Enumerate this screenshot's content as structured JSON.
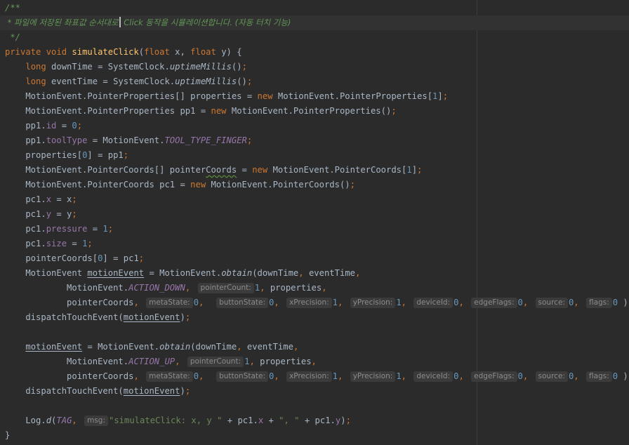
{
  "editor": {
    "theme": "darcula",
    "colors": {
      "background": "#2b2b2b",
      "current_line": "#323232",
      "keyword": "#cc7832",
      "comment": "#629755",
      "method": "#ffc66d",
      "field": "#9876aa",
      "number": "#6897bb",
      "string": "#6a8759",
      "default_text": "#a9b7c6",
      "inlay_hint_bg": "#3b3b3b",
      "inlay_hint_text": "#8c8c8c"
    },
    "lines": [
      {
        "current": false,
        "tokens": [
          {
            "t": "/**",
            "k": "comment"
          }
        ]
      },
      {
        "current": true,
        "tokens": [
          {
            "t": " * 파일에 저장된 좌표값 순서대로",
            "k": "comment"
          },
          {
            "caret": true
          },
          {
            "t": " Click 동작을 시뮬레이션합니다. (자동 터치 기능)",
            "k": "comment"
          }
        ]
      },
      {
        "current": false,
        "tokens": [
          {
            "t": " */",
            "k": "comment"
          }
        ]
      },
      {
        "current": false,
        "tokens": [
          {
            "t": "private ",
            "k": "kw"
          },
          {
            "t": "void ",
            "k": "kw"
          },
          {
            "t": "simulateClick",
            "k": "method"
          },
          {
            "t": "("
          },
          {
            "t": "float ",
            "k": "kw"
          },
          {
            "t": "x, "
          },
          {
            "t": "float ",
            "k": "kw"
          },
          {
            "t": "y) {"
          }
        ]
      },
      {
        "current": false,
        "tokens": [
          {
            "t": "    "
          },
          {
            "t": "long ",
            "k": "kw"
          },
          {
            "t": "downTime = SystemClock."
          },
          {
            "t": "uptimeMillis",
            "k": "italic"
          },
          {
            "t": "()"
          },
          {
            "t": ";",
            "k": "kw"
          }
        ]
      },
      {
        "current": false,
        "tokens": [
          {
            "t": "    "
          },
          {
            "t": "long ",
            "k": "kw"
          },
          {
            "t": "eventTime = SystemClock."
          },
          {
            "t": "uptimeMillis",
            "k": "italic"
          },
          {
            "t": "()"
          },
          {
            "t": ";",
            "k": "kw"
          }
        ]
      },
      {
        "current": false,
        "tokens": [
          {
            "t": "    MotionEvent.PointerProperties[] properties = "
          },
          {
            "t": "new ",
            "k": "kw"
          },
          {
            "t": "MotionEvent.PointerProperties["
          },
          {
            "t": "1",
            "k": "num"
          },
          {
            "t": "]"
          },
          {
            "t": ";",
            "k": "kw"
          }
        ]
      },
      {
        "current": false,
        "tokens": [
          {
            "t": "    MotionEvent.PointerProperties pp1 = "
          },
          {
            "t": "new ",
            "k": "kw"
          },
          {
            "t": "MotionEvent.PointerProperties()"
          },
          {
            "t": ";",
            "k": "kw"
          }
        ]
      },
      {
        "current": false,
        "tokens": [
          {
            "t": "    pp1."
          },
          {
            "t": "id",
            "k": "field"
          },
          {
            "t": " = "
          },
          {
            "t": "0",
            "k": "num"
          },
          {
            "t": ";",
            "k": "kw"
          }
        ]
      },
      {
        "current": false,
        "tokens": [
          {
            "t": "    pp1."
          },
          {
            "t": "toolType",
            "k": "field"
          },
          {
            "t": " = MotionEvent."
          },
          {
            "t": "TOOL_TYPE_FINGER",
            "k": "static"
          },
          {
            "t": ";",
            "k": "kw"
          }
        ]
      },
      {
        "current": false,
        "tokens": [
          {
            "t": "    properties["
          },
          {
            "t": "0",
            "k": "num"
          },
          {
            "t": "] = pp1"
          },
          {
            "t": ";",
            "k": "kw"
          }
        ]
      },
      {
        "current": false,
        "tokens": [
          {
            "t": "    MotionEvent.PointerCoords[] pointer"
          },
          {
            "t": "Coords",
            "k": "typo"
          },
          {
            "t": " = "
          },
          {
            "t": "new ",
            "k": "kw"
          },
          {
            "t": "MotionEvent.PointerCoords["
          },
          {
            "t": "1",
            "k": "num"
          },
          {
            "t": "]"
          },
          {
            "t": ";",
            "k": "kw"
          }
        ]
      },
      {
        "current": false,
        "tokens": [
          {
            "t": "    MotionEvent.PointerCoords pc1 = "
          },
          {
            "t": "new ",
            "k": "kw"
          },
          {
            "t": "MotionEvent.PointerCoords()"
          },
          {
            "t": ";",
            "k": "kw"
          }
        ]
      },
      {
        "current": false,
        "tokens": [
          {
            "t": "    pc1."
          },
          {
            "t": "x",
            "k": "field"
          },
          {
            "t": " = x"
          },
          {
            "t": ";",
            "k": "kw"
          }
        ]
      },
      {
        "current": false,
        "tokens": [
          {
            "t": "    pc1."
          },
          {
            "t": "y",
            "k": "field"
          },
          {
            "t": " = y"
          },
          {
            "t": ";",
            "k": "kw"
          }
        ]
      },
      {
        "current": false,
        "tokens": [
          {
            "t": "    pc1."
          },
          {
            "t": "pressure",
            "k": "field"
          },
          {
            "t": " = "
          },
          {
            "t": "1",
            "k": "num"
          },
          {
            "t": ";",
            "k": "kw"
          }
        ]
      },
      {
        "current": false,
        "tokens": [
          {
            "t": "    pc1."
          },
          {
            "t": "size",
            "k": "field"
          },
          {
            "t": " = "
          },
          {
            "t": "1",
            "k": "num"
          },
          {
            "t": ";",
            "k": "kw"
          }
        ]
      },
      {
        "current": false,
        "tokens": [
          {
            "t": "    pointerCoords["
          },
          {
            "t": "0",
            "k": "num"
          },
          {
            "t": "] = pc1"
          },
          {
            "t": ";",
            "k": "kw"
          }
        ]
      },
      {
        "current": false,
        "tokens": [
          {
            "t": "    MotionEvent "
          },
          {
            "t": "motionEvent",
            "k": "under"
          },
          {
            "t": " = MotionEvent."
          },
          {
            "t": "obtain",
            "k": "italic"
          },
          {
            "t": "(downTime"
          },
          {
            "t": ", ",
            "k": "kw"
          },
          {
            "t": "eventTime"
          },
          {
            "t": ",",
            "k": "kw"
          }
        ]
      },
      {
        "current": false,
        "tokens": [
          {
            "t": "            MotionEvent."
          },
          {
            "t": "ACTION_DOWN",
            "k": "static"
          },
          {
            "t": ", ",
            "k": "kw"
          },
          {
            "hint": "pointerCount:"
          },
          {
            "t": "1",
            "k": "num"
          },
          {
            "t": ", ",
            "k": "kw"
          },
          {
            "t": "properties"
          },
          {
            "t": ",",
            "k": "kw"
          }
        ]
      },
      {
        "current": false,
        "tokens": [
          {
            "t": "            pointerCoords"
          },
          {
            "t": ", ",
            "k": "kw"
          },
          {
            "hint": "metaState:"
          },
          {
            "t": "0",
            "k": "num"
          },
          {
            "t": ",  ",
            "k": "kw"
          },
          {
            "hint": "buttonState:"
          },
          {
            "t": "0",
            "k": "num"
          },
          {
            "t": ", ",
            "k": "kw"
          },
          {
            "hint": "xPrecision:"
          },
          {
            "t": "1",
            "k": "num"
          },
          {
            "t": ", ",
            "k": "kw"
          },
          {
            "hint": "yPrecision:"
          },
          {
            "t": "1",
            "k": "num"
          },
          {
            "t": ", ",
            "k": "kw"
          },
          {
            "hint": "deviceId:"
          },
          {
            "t": "0",
            "k": "num"
          },
          {
            "t": ", ",
            "k": "kw"
          },
          {
            "hint": "edgeFlags:"
          },
          {
            "t": "0",
            "k": "num"
          },
          {
            "t": ", ",
            "k": "kw"
          },
          {
            "hint": "source:"
          },
          {
            "t": "0",
            "k": "num"
          },
          {
            "t": ", ",
            "k": "kw"
          },
          {
            "hint": "flags:"
          },
          {
            "t": "0",
            "k": "num"
          },
          {
            "t": " )"
          },
          {
            "t": ";",
            "k": "kw"
          }
        ]
      },
      {
        "current": false,
        "tokens": [
          {
            "t": "    dispatchTouchEvent("
          },
          {
            "t": "motionEvent",
            "k": "under"
          },
          {
            "t": ")"
          },
          {
            "t": ";",
            "k": "kw"
          }
        ]
      },
      {
        "current": false,
        "tokens": [
          {
            "t": ""
          }
        ]
      },
      {
        "current": false,
        "tokens": [
          {
            "t": "    "
          },
          {
            "t": "motionEvent",
            "k": "under"
          },
          {
            "t": " = MotionEvent."
          },
          {
            "t": "obtain",
            "k": "italic"
          },
          {
            "t": "(downTime"
          },
          {
            "t": ", ",
            "k": "kw"
          },
          {
            "t": "eventTime"
          },
          {
            "t": ",",
            "k": "kw"
          }
        ]
      },
      {
        "current": false,
        "tokens": [
          {
            "t": "            MotionEvent."
          },
          {
            "t": "ACTION_UP",
            "k": "static"
          },
          {
            "t": ", ",
            "k": "kw"
          },
          {
            "hint": "pointerCount:"
          },
          {
            "t": "1",
            "k": "num"
          },
          {
            "t": ", ",
            "k": "kw"
          },
          {
            "t": "properties"
          },
          {
            "t": ",",
            "k": "kw"
          }
        ]
      },
      {
        "current": false,
        "tokens": [
          {
            "t": "            pointerCoords"
          },
          {
            "t": ", ",
            "k": "kw"
          },
          {
            "hint": "metaState:"
          },
          {
            "t": "0",
            "k": "num"
          },
          {
            "t": ",  ",
            "k": "kw"
          },
          {
            "hint": "buttonState:"
          },
          {
            "t": "0",
            "k": "num"
          },
          {
            "t": ", ",
            "k": "kw"
          },
          {
            "hint": "xPrecision:"
          },
          {
            "t": "1",
            "k": "num"
          },
          {
            "t": ", ",
            "k": "kw"
          },
          {
            "hint": "yPrecision:"
          },
          {
            "t": "1",
            "k": "num"
          },
          {
            "t": ", ",
            "k": "kw"
          },
          {
            "hint": "deviceId:"
          },
          {
            "t": "0",
            "k": "num"
          },
          {
            "t": ", ",
            "k": "kw"
          },
          {
            "hint": "edgeFlags:"
          },
          {
            "t": "0",
            "k": "num"
          },
          {
            "t": ", ",
            "k": "kw"
          },
          {
            "hint": "source:"
          },
          {
            "t": "0",
            "k": "num"
          },
          {
            "t": ", ",
            "k": "kw"
          },
          {
            "hint": "flags:"
          },
          {
            "t": "0",
            "k": "num"
          },
          {
            "t": " )"
          },
          {
            "t": ";",
            "k": "kw"
          }
        ]
      },
      {
        "current": false,
        "tokens": [
          {
            "t": "    dispatchTouchEvent("
          },
          {
            "t": "motionEvent",
            "k": "under"
          },
          {
            "t": ")"
          },
          {
            "t": ";",
            "k": "kw"
          }
        ]
      },
      {
        "current": false,
        "tokens": [
          {
            "t": ""
          }
        ]
      },
      {
        "current": false,
        "tokens": [
          {
            "t": "    Log."
          },
          {
            "t": "d",
            "k": "italic"
          },
          {
            "t": "("
          },
          {
            "t": "TAG",
            "k": "static"
          },
          {
            "t": ", ",
            "k": "kw"
          },
          {
            "hint": "msg:"
          },
          {
            "t": "\"simulateClick: x, y \"",
            "k": "str"
          },
          {
            "t": " + pc1."
          },
          {
            "t": "x",
            "k": "field"
          },
          {
            "t": " + "
          },
          {
            "t": "\", \"",
            "k": "str"
          },
          {
            "t": " + pc1."
          },
          {
            "t": "y",
            "k": "field"
          },
          {
            "t": ")"
          },
          {
            "t": ";",
            "k": "kw"
          }
        ]
      },
      {
        "current": false,
        "tokens": [
          {
            "t": "}"
          }
        ]
      }
    ]
  }
}
